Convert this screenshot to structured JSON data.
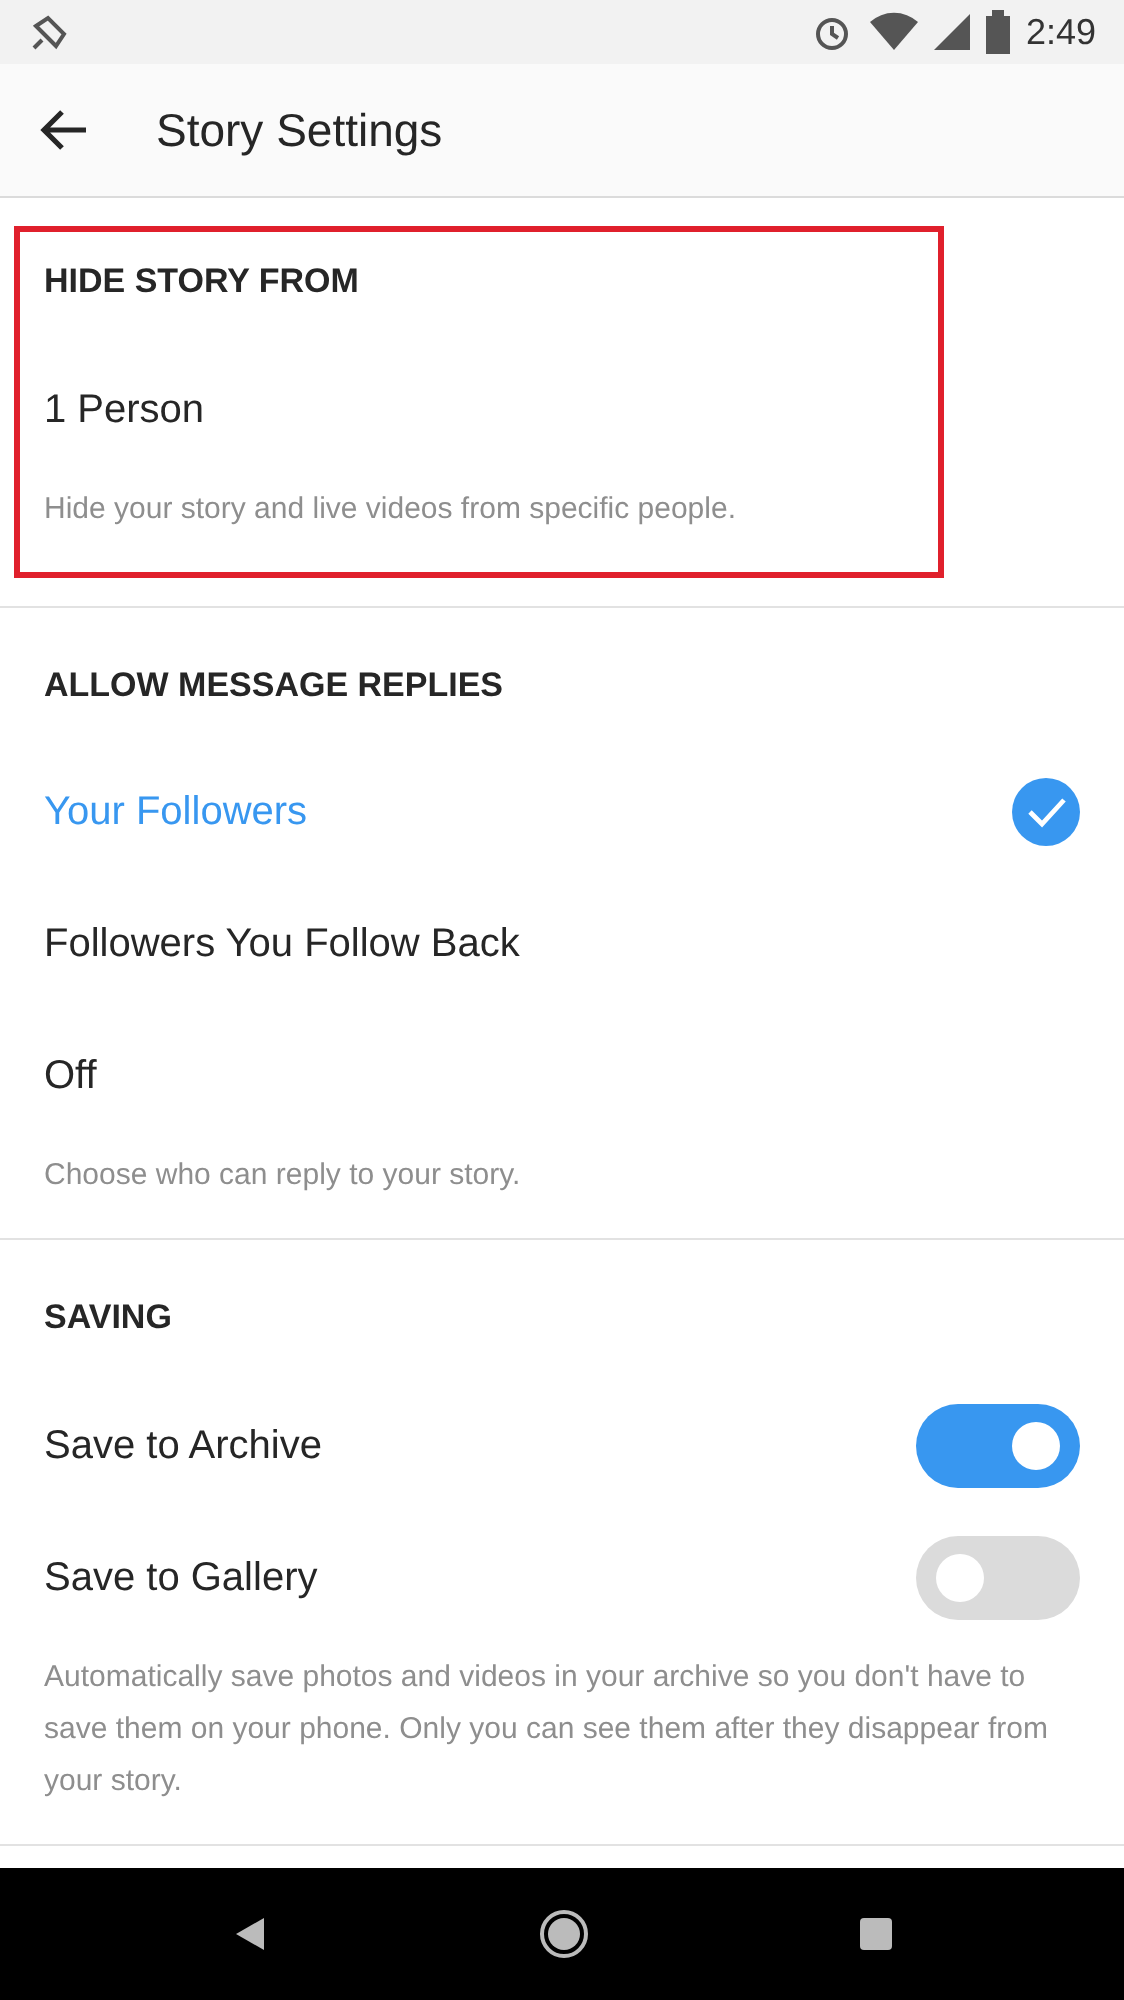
{
  "status_bar": {
    "time": "2:49"
  },
  "header": {
    "title": "Story Settings"
  },
  "sections": [
    {
      "heading": "HIDE STORY FROM",
      "highlighted": true,
      "rows": [
        {
          "kind": "link",
          "label": "1 Person"
        }
      ],
      "description": "Hide your story and live videos from specific people."
    },
    {
      "heading": "ALLOW MESSAGE REPLIES",
      "highlighted": false,
      "rows": [
        {
          "kind": "radio",
          "label": "Your Followers",
          "selected": true
        },
        {
          "kind": "radio",
          "label": "Followers You Follow Back",
          "selected": false
        },
        {
          "kind": "radio",
          "label": "Off",
          "selected": false
        }
      ],
      "description": "Choose who can reply to your story."
    },
    {
      "heading": "SAVING",
      "highlighted": false,
      "rows": [
        {
          "kind": "toggle",
          "label": "Save to Archive",
          "on": true
        },
        {
          "kind": "toggle",
          "label": "Save to Gallery",
          "on": false
        }
      ],
      "description": "Automatically save photos and videos in your archive so you don't have to save them on your phone. Only you can see them after they disappear from your story."
    }
  ]
}
